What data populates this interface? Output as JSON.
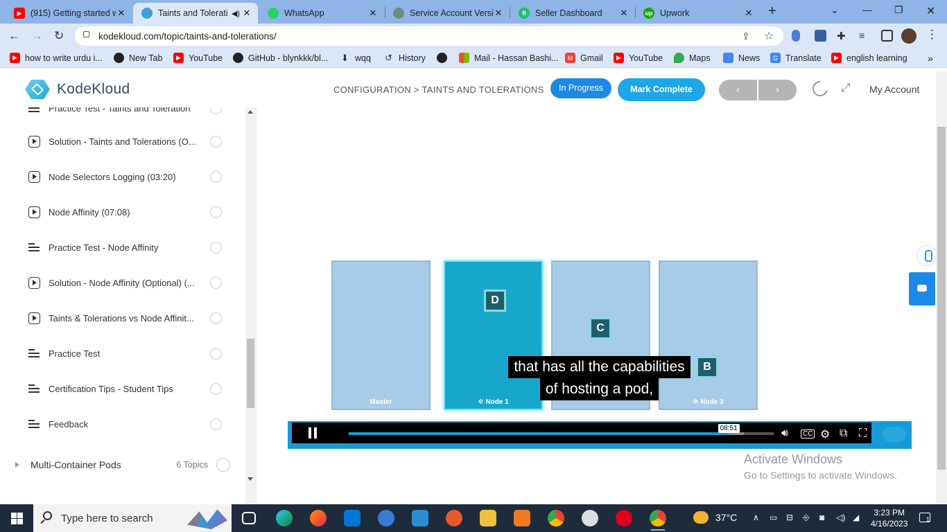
{
  "browser": {
    "tabs": [
      {
        "title": "(915) Getting started w",
        "favicon_color": "#ff0000",
        "active": false
      },
      {
        "title": "Taints and Tolerati",
        "favicon_color": "#3ea0d8",
        "active": true
      },
      {
        "title": "WhatsApp",
        "favicon_color": "#25d366",
        "active": false
      },
      {
        "title": "Service Account Versic",
        "favicon_color": "#6b8e7a",
        "active": false
      },
      {
        "title": "Seller Dashboard",
        "favicon_color": "#1dbf73",
        "active": false
      },
      {
        "title": "Upwork",
        "favicon_color": "#14a800",
        "active": false
      }
    ],
    "url": "kodekloud.com/topic/taints-and-tolerations/",
    "bookmarks": [
      {
        "label": "how to write urdu i...",
        "color": "#ff0000"
      },
      {
        "label": "New Tab",
        "color": "#222"
      },
      {
        "label": "YouTube",
        "color": "#ff0000"
      },
      {
        "label": "GitHub - blynkkk/bl...",
        "color": "#222"
      },
      {
        "label": "wqq",
        "color": "#333"
      },
      {
        "label": "History",
        "color": "#333"
      },
      {
        "label": "",
        "color": "#222"
      },
      {
        "label": "Mail - Hassan Bashi...",
        "color": "#f25022"
      },
      {
        "label": "Gmail",
        "color": "#ea4335"
      },
      {
        "label": "YouTube",
        "color": "#ff0000"
      },
      {
        "label": "Maps",
        "color": "#34a853"
      },
      {
        "label": "News",
        "color": "#4285f4"
      },
      {
        "label": "Translate",
        "color": "#4285f4"
      },
      {
        "label": "english learning",
        "color": "#ff0000"
      }
    ]
  },
  "site": {
    "logo_text": "KodeKloud",
    "breadcrumb": "CONFIGURATION > TAINTS AND TOLERATIONS",
    "in_progress_label": "In Progress",
    "mark_complete_label": "Mark Complete",
    "prev_label": "‹",
    "next_label": "›",
    "account_label": "My Account"
  },
  "sidebar": {
    "items": [
      {
        "label": "Practice Test - Taints and Toleration",
        "type": "quiz"
      },
      {
        "label": "Solution - Taints and Tolerations (O...",
        "type": "video"
      },
      {
        "label": "Node Selectors Logging (03:20)",
        "type": "video"
      },
      {
        "label": "Node Affinity (07:08)",
        "type": "video"
      },
      {
        "label": "Practice Test - Node Affinity",
        "type": "quiz"
      },
      {
        "label": "Solution - Node Affinity (Optional) (...",
        "type": "video"
      },
      {
        "label": "Taints & Tolerations vs Node Affinit...",
        "type": "video"
      },
      {
        "label": "Practice Test",
        "type": "quiz"
      },
      {
        "label": "Certification Tips - Student Tips",
        "type": "quiz"
      },
      {
        "label": "Feedback",
        "type": "quiz"
      }
    ],
    "section": {
      "label": "Multi-Container Pods",
      "count": "6 Topics"
    }
  },
  "video": {
    "nodes": [
      {
        "label": "Master",
        "active": false
      },
      {
        "label": "Node 1",
        "active": true
      },
      {
        "label": "",
        "active": false
      },
      {
        "label": "Node 3",
        "active": false
      }
    ],
    "pods": [
      "D",
      "C",
      "B"
    ],
    "caption_line1": "that has all the capabilities",
    "caption_line2": "of hosting a pod,",
    "timecode": "08:51",
    "progress_fraction": 0.895,
    "buffered_fraction": 0.93
  },
  "watermark": {
    "line1": "Activate Windows",
    "line2": "Go to Settings to activate Windows."
  },
  "taskbar": {
    "search_placeholder": "Type here to search",
    "weather": "37°C",
    "time": "3:23 PM",
    "date": "4/16/2023",
    "notif_count": "1"
  }
}
